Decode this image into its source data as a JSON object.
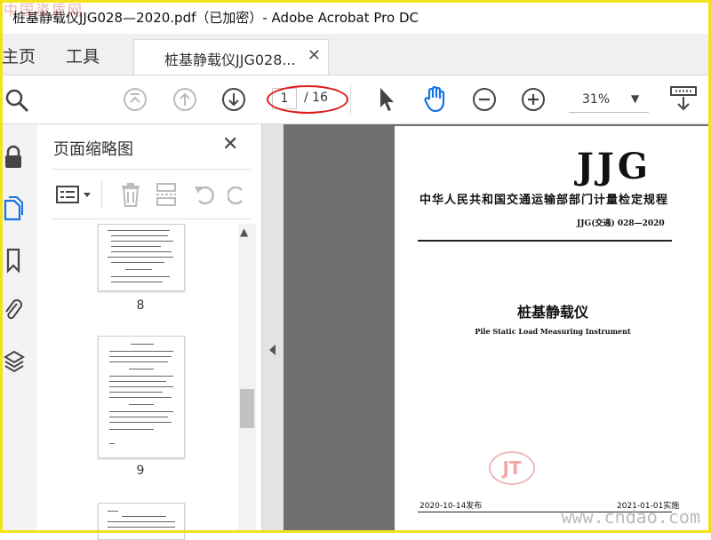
{
  "window": {
    "title": "桩基静载仪JJG028—2020.pdf（已加密）- Adobe Acrobat Pro DC"
  },
  "tabs": {
    "home": "主页",
    "tools": "工具",
    "document_tab": "桩基静载仪JJG028..."
  },
  "toolbar": {
    "current_page": "1",
    "total_pages": "/ 16",
    "zoom": "31%"
  },
  "panel": {
    "title": "页面缩略图",
    "thumbnails": [
      {
        "label": "8"
      },
      {
        "label": "9"
      },
      {
        "label": ""
      }
    ]
  },
  "document": {
    "logo_text": "JJG",
    "org_line": "中华人民共和国交通运输部部门计量检定规程",
    "code": "JJG(交通) 028—2020",
    "title_cn": "桩基静载仪",
    "title_en": "Pile Static Load Measuring Instrument",
    "stamp_text": "JT",
    "issue_date": "2020-10-14发布",
    "impl_date": "2021-01-01实施"
  },
  "watermarks": {
    "top_left": "中国资质网",
    "bottom_right": "www.cndao.com"
  },
  "colors": {
    "accent_blue": "#1473e6",
    "annotation_red": "#e01818",
    "frame_yellow": "#f2e21a"
  }
}
